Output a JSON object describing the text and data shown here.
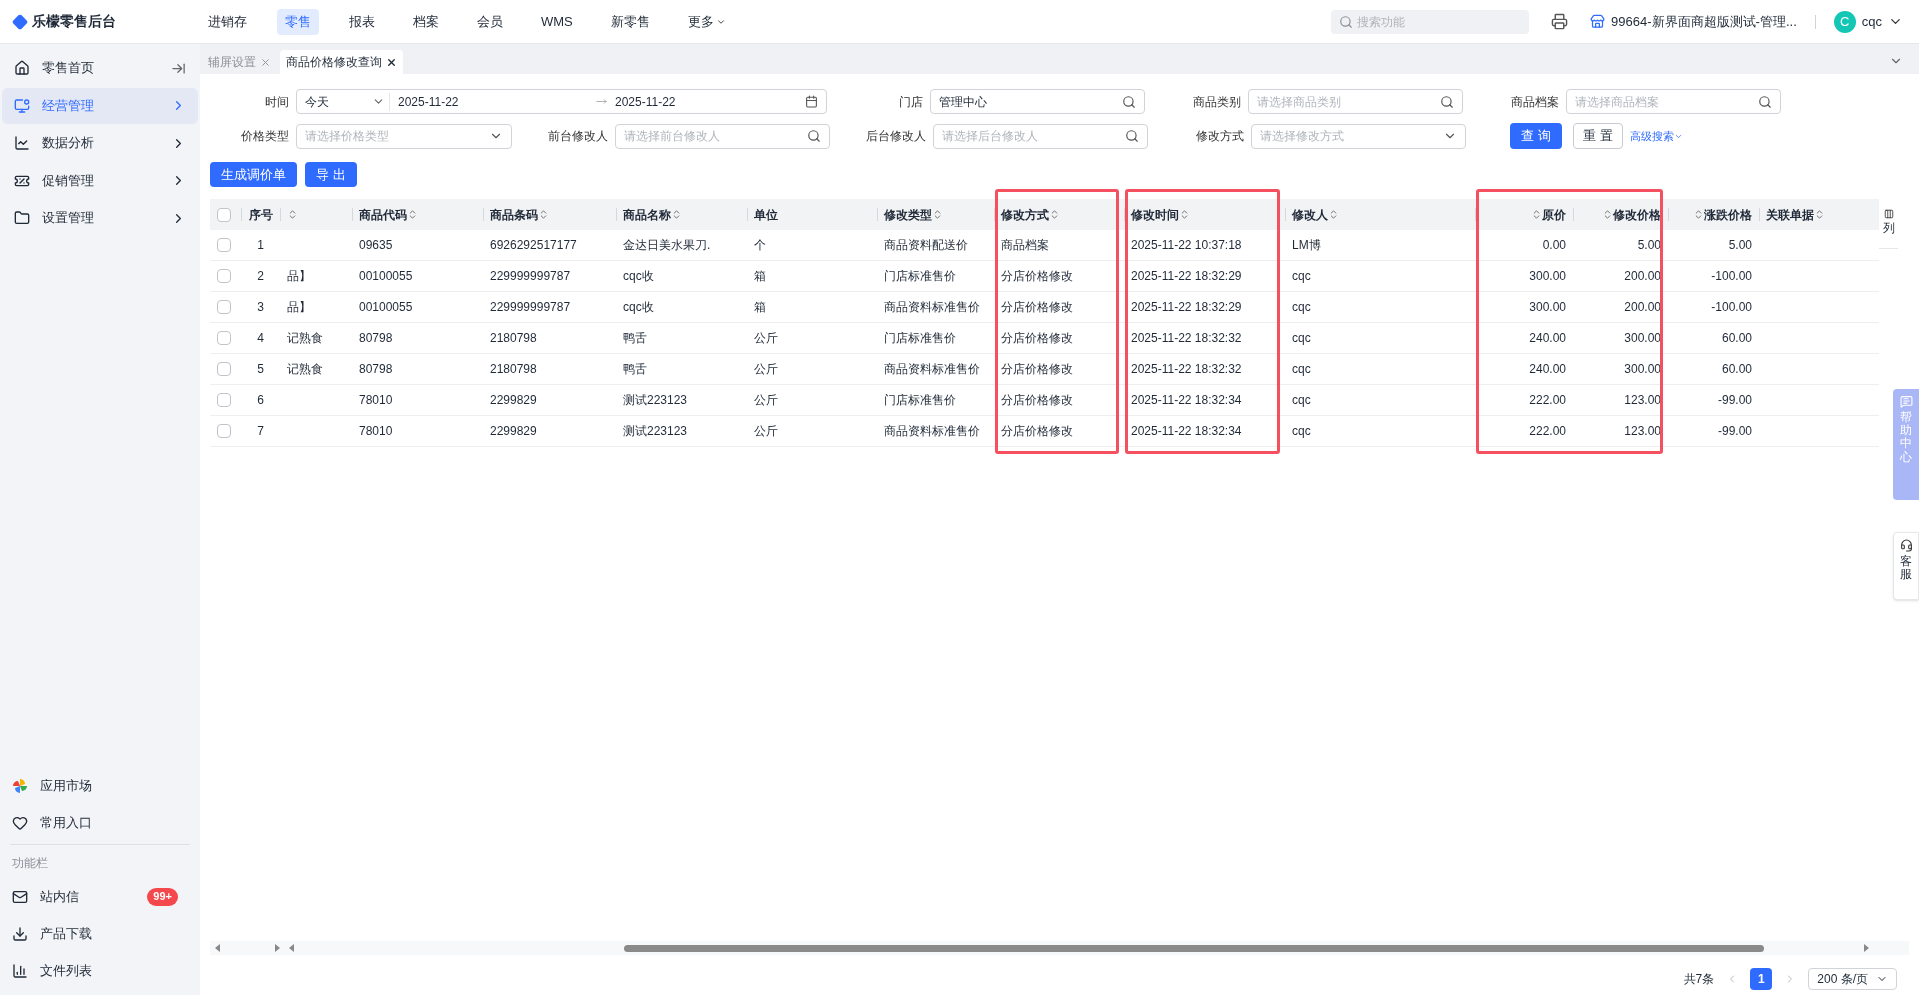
{
  "app": {
    "logo": "乐檬零售后台",
    "nav": [
      {
        "label": "进销存",
        "selected": false
      },
      {
        "label": "零售",
        "selected": true
      },
      {
        "label": "报表",
        "selected": false
      },
      {
        "label": "档案",
        "selected": false
      },
      {
        "label": "会员",
        "selected": false
      },
      {
        "label": "WMS",
        "selected": false
      },
      {
        "label": "新零售",
        "selected": false
      },
      {
        "label": "更多",
        "selected": false,
        "dropdown": true
      }
    ],
    "search_placeholder": "搜索功能",
    "store": "99664-新界面商超版测试-管理...",
    "user": {
      "initial": "C",
      "name": "cqc"
    }
  },
  "sidebar": {
    "menu": [
      {
        "label": "零售首页",
        "kind": "home",
        "selected": false
      },
      {
        "label": "经营管理",
        "kind": "business",
        "selected": true
      },
      {
        "label": "数据分析",
        "kind": "analytics",
        "selected": false
      },
      {
        "label": "促销管理",
        "kind": "promotion",
        "selected": false
      },
      {
        "label": "设置管理",
        "kind": "settings",
        "selected": false
      }
    ],
    "bottom": [
      {
        "label": "应用市场",
        "kind": "market"
      },
      {
        "label": "常用入口",
        "kind": "favorites"
      }
    ],
    "section_label": "功能栏",
    "tools": [
      {
        "label": "站内信",
        "kind": "mail",
        "badge": "99+"
      },
      {
        "label": "产品下载",
        "kind": "download"
      },
      {
        "label": "文件列表",
        "kind": "files"
      }
    ]
  },
  "tabs": [
    {
      "label": "辅屏设置",
      "selected": false
    },
    {
      "label": "商品价格修改查询",
      "selected": true
    }
  ],
  "filter_rows": [
    [
      {
        "label": "时间",
        "kind": "date_range",
        "preset": "今天",
        "start": "2025-11-22",
        "end": "2025-11-22"
      },
      {
        "label": "门店",
        "kind": "search",
        "value": "管理中心"
      },
      {
        "label": "商品类别",
        "kind": "search",
        "placeholder": "请选择商品类别"
      },
      {
        "label": "商品档案",
        "kind": "search",
        "placeholder": "请选择商品档案"
      }
    ],
    [
      {
        "label": "价格类型",
        "kind": "select",
        "placeholder": "请选择价格类型"
      },
      {
        "label": "前台修改人",
        "kind": "search",
        "placeholder": "请选择前台修改人"
      },
      {
        "label": "后台修改人",
        "kind": "search",
        "placeholder": "请选择后台修改人"
      },
      {
        "label": "修改方式",
        "kind": "select",
        "placeholder": "请选择修改方式"
      }
    ]
  ],
  "filter_buttons": {
    "query": "查 询",
    "reset": "重 置",
    "advanced": "高级搜索"
  },
  "actions": [
    "生成调价单",
    "导 出"
  ],
  "table": {
    "all_checked": false,
    "columns": [
      {
        "label": "序号",
        "kind": "index",
        "sortable": false
      },
      {
        "kind": "text",
        "sortable": true
      },
      {
        "label": "商品代码",
        "kind": "text",
        "sortable": true
      },
      {
        "label": "商品条码",
        "kind": "text",
        "sortable": true
      },
      {
        "label": "商品名称",
        "kind": "text",
        "sortable": true
      },
      {
        "label": "单位",
        "kind": "text",
        "sortable": false
      },
      {
        "label": "修改类型",
        "kind": "text",
        "sortable": true
      },
      {
        "label": "修改方式",
        "kind": "text",
        "sortable": true,
        "highlighted": true
      },
      {
        "label": "修改时间",
        "kind": "text",
        "sortable": true,
        "highlighted": true
      },
      {
        "label": "修改人",
        "kind": "text",
        "sortable": true
      },
      {
        "label": "原价",
        "kind": "number",
        "sortable": true,
        "highlighted": true,
        "frame_joins_next": true
      },
      {
        "label": "修改价格",
        "kind": "number",
        "sortable": true,
        "highlighted": true
      },
      {
        "label": "涨跌价格",
        "kind": "number",
        "sortable": true
      },
      {
        "label": "关联单据",
        "kind": "text",
        "sortable": true
      }
    ],
    "rows": [
      {
        "checked": false,
        "cells": [
          "1",
          null,
          "09635",
          "6926292517177",
          "金达日美水果刀.",
          "个",
          "商品资料配送价",
          "商品档案",
          "2025-11-22 10:37:18",
          "LM博",
          "0.00",
          "5.00",
          "5.00",
          null
        ]
      },
      {
        "checked": false,
        "cells": [
          "2",
          "品】",
          "00100055",
          "229999999787",
          "cqc收",
          "箱",
          "门店标准售价",
          "分店价格修改",
          "2025-11-22 18:32:29",
          "cqc",
          "300.00",
          "200.00",
          "-100.00",
          null
        ]
      },
      {
        "checked": false,
        "cells": [
          "3",
          "品】",
          "00100055",
          "229999999787",
          "cqc收",
          "箱",
          "商品资料标准售价",
          "分店价格修改",
          "2025-11-22 18:32:29",
          "cqc",
          "300.00",
          "200.00",
          "-100.00",
          null
        ]
      },
      {
        "checked": false,
        "cells": [
          "4",
          "记熟食",
          "80798",
          "2180798",
          "鸭舌",
          "公斤",
          "门店标准售价",
          "分店价格修改",
          "2025-11-22 18:32:32",
          "cqc",
          "240.00",
          "300.00",
          "60.00",
          null
        ]
      },
      {
        "checked": false,
        "cells": [
          "5",
          "记熟食",
          "80798",
          "2180798",
          "鸭舌",
          "公斤",
          "商品资料标准售价",
          "分店价格修改",
          "2025-11-22 18:32:32",
          "cqc",
          "240.00",
          "300.00",
          "60.00",
          null
        ]
      },
      {
        "checked": false,
        "cells": [
          "6",
          null,
          "78010",
          "2299829",
          "测试223123",
          "公斤",
          "门店标准售价",
          "分店价格修改",
          "2025-11-22 18:32:34",
          "cqc",
          "222.00",
          "123.00",
          "-99.00",
          null
        ]
      },
      {
        "checked": false,
        "cells": [
          "7",
          null,
          "78010",
          "2299829",
          "测试223123",
          "公斤",
          "商品资料标准售价",
          "分店价格修改",
          "2025-11-22 18:32:34",
          "cqc",
          "222.00",
          "123.00",
          "-99.00",
          null
        ]
      }
    ]
  },
  "column_settings": "列",
  "pagination": {
    "total": "共7条",
    "pages": [
      {
        "label": "1",
        "selected": true
      }
    ],
    "page_size": "200 条/页"
  },
  "help": {
    "help_center": "帮助中心",
    "service": "客服"
  }
}
